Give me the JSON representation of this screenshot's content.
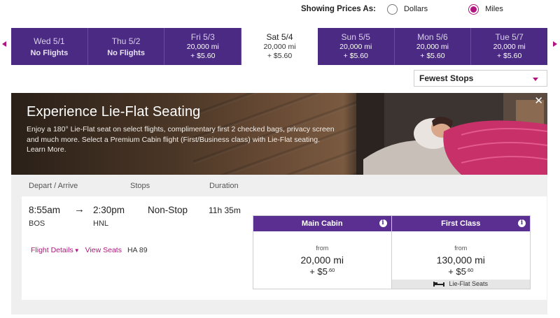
{
  "price_toggle": {
    "label": "Showing Prices As:",
    "options": [
      {
        "label": "Dollars",
        "selected": false
      },
      {
        "label": "Miles",
        "selected": true
      }
    ]
  },
  "dates": [
    {
      "day": "Wed 5/1",
      "no_flights": "No Flights",
      "miles": "",
      "usd": "",
      "active": false
    },
    {
      "day": "Thu 5/2",
      "no_flights": "No Flights",
      "miles": "",
      "usd": "",
      "active": false
    },
    {
      "day": "Fri 5/3",
      "no_flights": "",
      "miles": "20,000 mi",
      "usd": "+ $5.60",
      "active": false
    },
    {
      "day": "Sat 5/4",
      "no_flights": "",
      "miles": "20,000 mi",
      "usd": "+ $5.60",
      "active": true
    },
    {
      "day": "Sun 5/5",
      "no_flights": "",
      "miles": "20,000 mi",
      "usd": "+ $5.60",
      "active": false
    },
    {
      "day": "Mon 5/6",
      "no_flights": "",
      "miles": "20,000 mi",
      "usd": "+ $5.60",
      "active": false
    },
    {
      "day": "Tue 5/7",
      "no_flights": "",
      "miles": "20,000 mi",
      "usd": "+ $5.60",
      "active": false
    }
  ],
  "sort": {
    "selected": "Fewest Stops"
  },
  "banner": {
    "title": "Experience Lie-Flat Seating",
    "description": "Enjoy a 180° Lie-Flat seat on select flights, complimentary first 2 checked bags, privacy screen and much more. Select a Premium Cabin flight (First/Business class) with Lie-Flat seating.",
    "learn_more": "Learn More.",
    "close": "✕"
  },
  "columns": {
    "depart_arrive": "Depart / Arrive",
    "stops": "Stops",
    "duration": "Duration"
  },
  "flight": {
    "depart_time": "8:55am",
    "depart_code": "BOS",
    "arrow": "→",
    "arrive_time": "2:30pm",
    "arrive_code": "HNL",
    "stops": "Non-Stop",
    "duration": "11h 35m",
    "details_link": "Flight Details",
    "seats_link": "View Seats",
    "flight_number": "HA 89",
    "fares": [
      {
        "cabin": "Main Cabin",
        "from": "from",
        "miles": "20,000 mi",
        "usd_main": "+ $5",
        "usd_cents": ".60",
        "feature": ""
      },
      {
        "cabin": "First Class",
        "from": "from",
        "miles": "130,000 mi",
        "usd_main": "+ $5",
        "usd_cents": ".60",
        "feature": "Lie-Flat Seats"
      }
    ]
  },
  "colors": {
    "purple": "#4a2a82",
    "cabin_header": "#5a2f91",
    "accent": "#b0147f"
  },
  "icons": [
    "chevron-left-icon",
    "chevron-right-icon",
    "close-icon",
    "info-icon",
    "caret-down-icon",
    "bed-icon"
  ]
}
